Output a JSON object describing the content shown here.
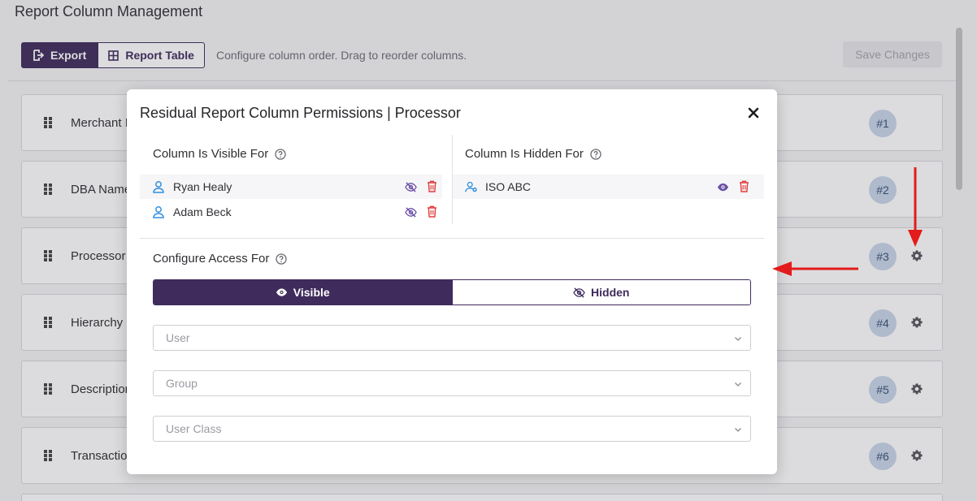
{
  "page": {
    "title": "Report Column Management",
    "toolbar": {
      "export_label": "Export",
      "report_table_label": "Report Table",
      "hint": "Configure column order. Drag to reorder columns.",
      "save_label": "Save Changes"
    },
    "columns": [
      {
        "name": "Merchant I",
        "number": "#1",
        "has_gear": false
      },
      {
        "name": "DBA Name",
        "number": "#2",
        "has_gear": false
      },
      {
        "name": "Processor",
        "number": "#3",
        "has_gear": true
      },
      {
        "name": "Hierarchy",
        "number": "#4",
        "has_gear": true
      },
      {
        "name": "Description",
        "number": "#5",
        "has_gear": true
      },
      {
        "name": "Transaction",
        "number": "#6",
        "has_gear": true
      }
    ]
  },
  "modal": {
    "title": "Residual Report Column Permissions | Processor",
    "visible_for": {
      "heading": "Column Is Visible For",
      "entries": [
        {
          "label": "Ryan Healy",
          "icon": "user-icon"
        },
        {
          "label": "Adam Beck",
          "icon": "user-icon"
        }
      ]
    },
    "hidden_for": {
      "heading": "Column Is Hidden For",
      "entries": [
        {
          "label": "ISO ABC",
          "icon": "user-group-icon"
        }
      ]
    },
    "configure": {
      "heading": "Configure Access For",
      "toggle": {
        "visible_label": "Visible",
        "hidden_label": "Hidden",
        "selected": "Visible"
      },
      "selects": [
        {
          "placeholder": "User"
        },
        {
          "placeholder": "Group"
        },
        {
          "placeholder": "User Class"
        }
      ]
    }
  },
  "colors": {
    "primary": "#3f2b5c",
    "user_icon": "#2f8fe0",
    "hide_icon": "#6b4fa6",
    "delete_icon": "#e03a3a",
    "badge_bg": "#c9d6ea",
    "annotation_arrow": "#e31b1b"
  }
}
